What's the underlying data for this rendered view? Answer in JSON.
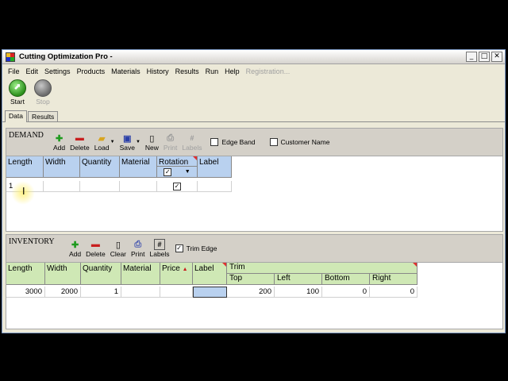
{
  "window": {
    "title": "Cutting Optimization Pro -",
    "min": "_",
    "max": "□",
    "close": "✕"
  },
  "menu": [
    "File",
    "Edit",
    "Settings",
    "Products",
    "Materials",
    "History",
    "Results",
    "Run",
    "Help",
    "Registration..."
  ],
  "run": {
    "start": "Start",
    "stop": "Stop"
  },
  "tabs": [
    "Data",
    "Results"
  ],
  "demand": {
    "title": "DEMAND",
    "buttons": {
      "add": "Add",
      "delete": "Delete",
      "load": "Load",
      "save": "Save",
      "new": "New",
      "print": "Print",
      "labels": "Labels"
    },
    "edge_band": "Edge Band",
    "customer_name": "Customer Name",
    "columns": [
      "Length",
      "Width",
      "Quantity",
      "Material",
      "Rotation",
      "Label"
    ],
    "rotation_check": "✓",
    "rotation_arrow": "▼",
    "row": {
      "length": "1",
      "rotation": "✓"
    }
  },
  "inventory": {
    "title": "INVENTORY",
    "buttons": {
      "add": "Add",
      "delete": "Delete",
      "clear": "Clear",
      "print": "Print",
      "labels": "Labels"
    },
    "trim_edge": "Trim Edge",
    "trim_edge_check": "✓",
    "columns": [
      "Length",
      "Width",
      "Quantity",
      "Material",
      "Price",
      "Label"
    ],
    "price_arrow": "▲",
    "trim": "Trim",
    "trim_cols": [
      "Top",
      "Left",
      "Bottom",
      "Right"
    ],
    "row": [
      "3000",
      "2000",
      "1",
      "",
      "",
      "",
      "200",
      "100",
      "0",
      "0"
    ]
  }
}
